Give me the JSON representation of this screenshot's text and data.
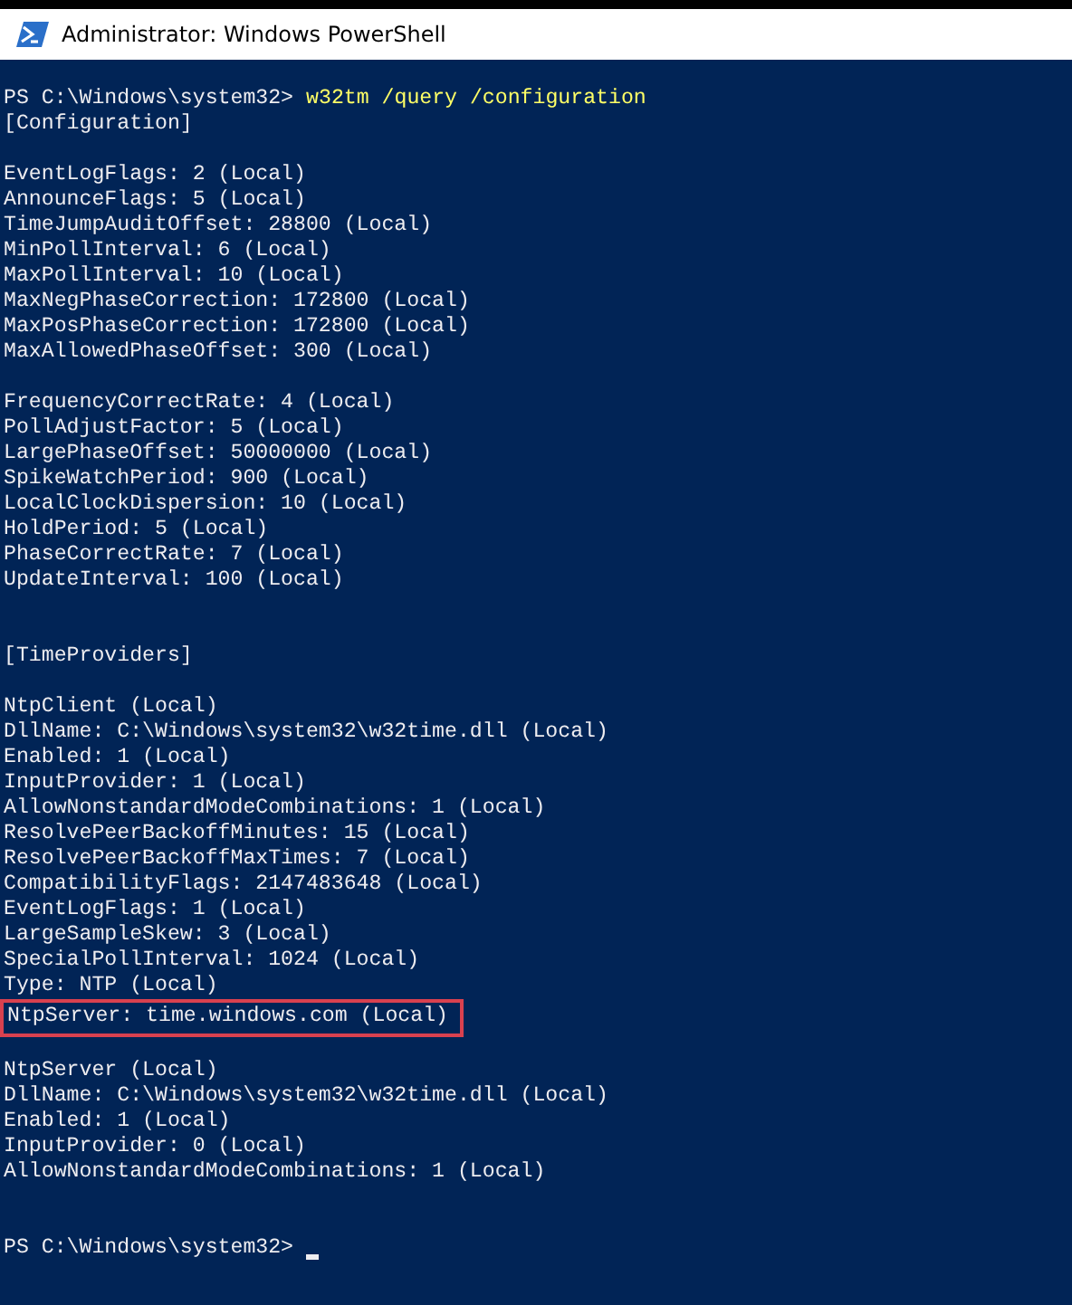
{
  "window": {
    "title": "Administrator: Windows PowerShell"
  },
  "lines": [
    {
      "kind": "prompt",
      "prompt": "PS C:\\Windows\\system32>",
      "command": "w32tm /query /configuration",
      "cursor": false
    },
    {
      "kind": "text",
      "text": "[Configuration]"
    },
    {
      "kind": "blank"
    },
    {
      "kind": "text",
      "text": "EventLogFlags: 2 (Local)"
    },
    {
      "kind": "text",
      "text": "AnnounceFlags: 5 (Local)"
    },
    {
      "kind": "text",
      "text": "TimeJumpAuditOffset: 28800 (Local)"
    },
    {
      "kind": "text",
      "text": "MinPollInterval: 6 (Local)"
    },
    {
      "kind": "text",
      "text": "MaxPollInterval: 10 (Local)"
    },
    {
      "kind": "text",
      "text": "MaxNegPhaseCorrection: 172800 (Local)"
    },
    {
      "kind": "text",
      "text": "MaxPosPhaseCorrection: 172800 (Local)"
    },
    {
      "kind": "text",
      "text": "MaxAllowedPhaseOffset: 300 (Local)"
    },
    {
      "kind": "blank"
    },
    {
      "kind": "text",
      "text": "FrequencyCorrectRate: 4 (Local)"
    },
    {
      "kind": "text",
      "text": "PollAdjustFactor: 5 (Local)"
    },
    {
      "kind": "text",
      "text": "LargePhaseOffset: 50000000 (Local)"
    },
    {
      "kind": "text",
      "text": "SpikeWatchPeriod: 900 (Local)"
    },
    {
      "kind": "text",
      "text": "LocalClockDispersion: 10 (Local)"
    },
    {
      "kind": "text",
      "text": "HoldPeriod: 5 (Local)"
    },
    {
      "kind": "text",
      "text": "PhaseCorrectRate: 7 (Local)"
    },
    {
      "kind": "text",
      "text": "UpdateInterval: 100 (Local)"
    },
    {
      "kind": "blank"
    },
    {
      "kind": "blank"
    },
    {
      "kind": "text",
      "text": "[TimeProviders]"
    },
    {
      "kind": "blank"
    },
    {
      "kind": "text",
      "text": "NtpClient (Local)"
    },
    {
      "kind": "text",
      "text": "DllName: C:\\Windows\\system32\\w32time.dll (Local)"
    },
    {
      "kind": "text",
      "text": "Enabled: 1 (Local)"
    },
    {
      "kind": "text",
      "text": "InputProvider: 1 (Local)"
    },
    {
      "kind": "text",
      "text": "AllowNonstandardModeCombinations: 1 (Local)"
    },
    {
      "kind": "text",
      "text": "ResolvePeerBackoffMinutes: 15 (Local)"
    },
    {
      "kind": "text",
      "text": "ResolvePeerBackoffMaxTimes: 7 (Local)"
    },
    {
      "kind": "text",
      "text": "CompatibilityFlags: 2147483648 (Local)"
    },
    {
      "kind": "text",
      "text": "EventLogFlags: 1 (Local)"
    },
    {
      "kind": "text",
      "text": "LargeSampleSkew: 3 (Local)"
    },
    {
      "kind": "text",
      "text": "SpecialPollInterval: 1024 (Local)"
    },
    {
      "kind": "text",
      "text": "Type: NTP (Local)"
    },
    {
      "kind": "highlighted",
      "text": "NtpServer: time.windows.com (Local)"
    },
    {
      "kind": "blank"
    },
    {
      "kind": "text",
      "text": "NtpServer (Local)"
    },
    {
      "kind": "text",
      "text": "DllName: C:\\Windows\\system32\\w32time.dll (Local)"
    },
    {
      "kind": "text",
      "text": "Enabled: 1 (Local)"
    },
    {
      "kind": "text",
      "text": "InputProvider: 0 (Local)"
    },
    {
      "kind": "text",
      "text": "AllowNonstandardModeCombinations: 1 (Local)"
    },
    {
      "kind": "blank"
    },
    {
      "kind": "blank"
    },
    {
      "kind": "prompt",
      "prompt": "PS C:\\Windows\\system32>",
      "cursor": true
    }
  ]
}
